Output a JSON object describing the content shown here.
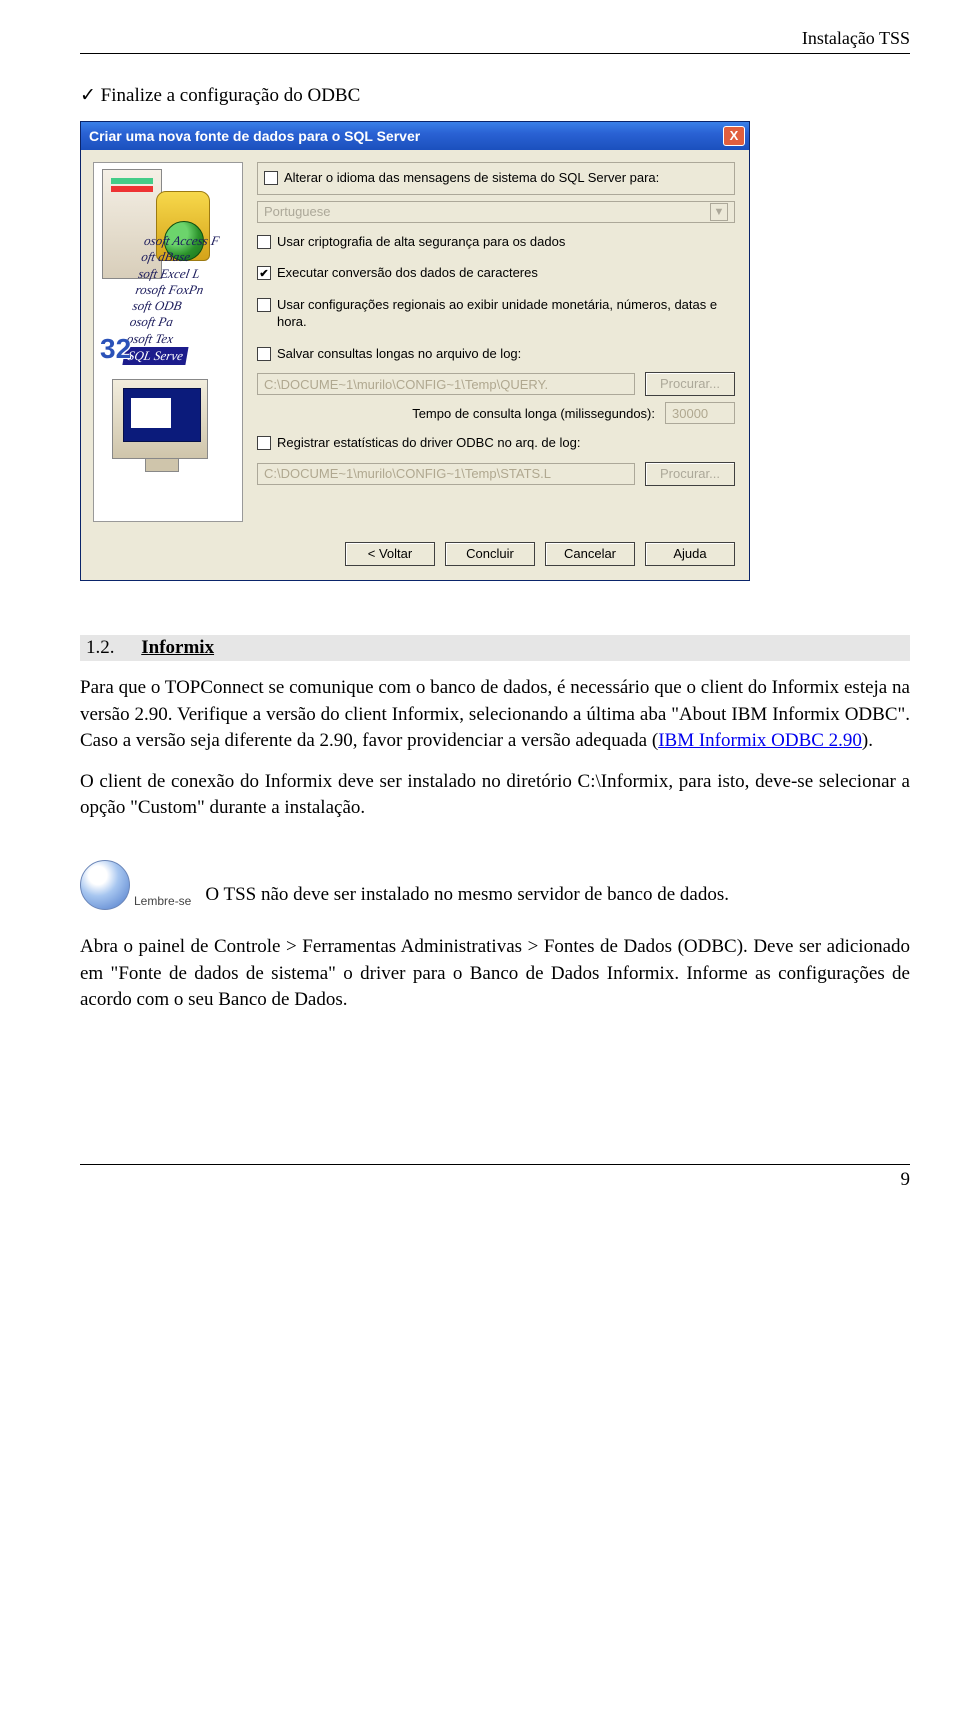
{
  "header": {
    "doc_title": "Instalação TSS"
  },
  "check": {
    "mark": "✓",
    "text": "Finalize a configuração do ODBC"
  },
  "dialog": {
    "title": "Criar uma nova fonte de dados para o SQL Server",
    "close": "X",
    "illus": {
      "lines": [
        "osoft Access F",
        "oft dBase",
        "soft Excel L",
        "rosoft FoxPn",
        "soft ODB",
        "osoft Pa",
        "osoft Tex",
        "SQL Serve"
      ],
      "badge": "32"
    },
    "opt_alterar": "Alterar o idioma das mensagens de sistema do SQL Server para:",
    "lang_value": "Portuguese",
    "opt_cripto": "Usar criptografia de alta segurança para os dados",
    "opt_conversao": "Executar conversão dos dados de caracteres",
    "opt_regionais": "Usar configurações regionais ao exibir unidade monetária, números, datas e hora.",
    "opt_salvar": "Salvar consultas longas no arquivo de log:",
    "query_path": "C:\\DOCUME~1\\murilo\\CONFIG~1\\Temp\\QUERY.",
    "procurar": "Procurar...",
    "tempo_label": "Tempo de consulta longa (milissegundos):",
    "tempo_value": "30000",
    "opt_registrar": "Registrar estatísticas do driver ODBC no arq. de log:",
    "stats_path": "C:\\DOCUME~1\\murilo\\CONFIG~1\\Temp\\STATS.L",
    "btn_voltar": "< Voltar",
    "btn_concluir": "Concluir",
    "btn_cancelar": "Cancelar",
    "btn_ajuda": "Ajuda"
  },
  "section": {
    "num": "1.2.",
    "title": "Informix"
  },
  "para1a": "Para que o TOPConnect se comunique com o banco de dados, é necessário que o client do Informix esteja na versão 2.90. Verifique a versão do client Informix, selecionando a última aba \"About IBM Informix ODBC\". Caso a versão seja diferente da 2.90, favor providenciar a versão adequada (",
  "para1_link": "IBM Informix ODBC 2.90",
  "para1b": ").",
  "para2": "O client de conexão do Informix deve ser instalado no diretório C:\\Informix, para isto, deve-se selecionar a opção \"Custom\" durante a instalação.",
  "lembre": {
    "label": "Lembre-se",
    "text": "O TSS não deve ser instalado no mesmo servidor de banco de dados."
  },
  "para3": "Abra o painel de Controle > Ferramentas Administrativas > Fontes de Dados (ODBC). Deve ser adicionado em \"Fonte de dados de sistema\" o driver para o Banco de Dados Informix. Informe as configurações de acordo com o seu Banco de Dados.",
  "page_num": "9"
}
